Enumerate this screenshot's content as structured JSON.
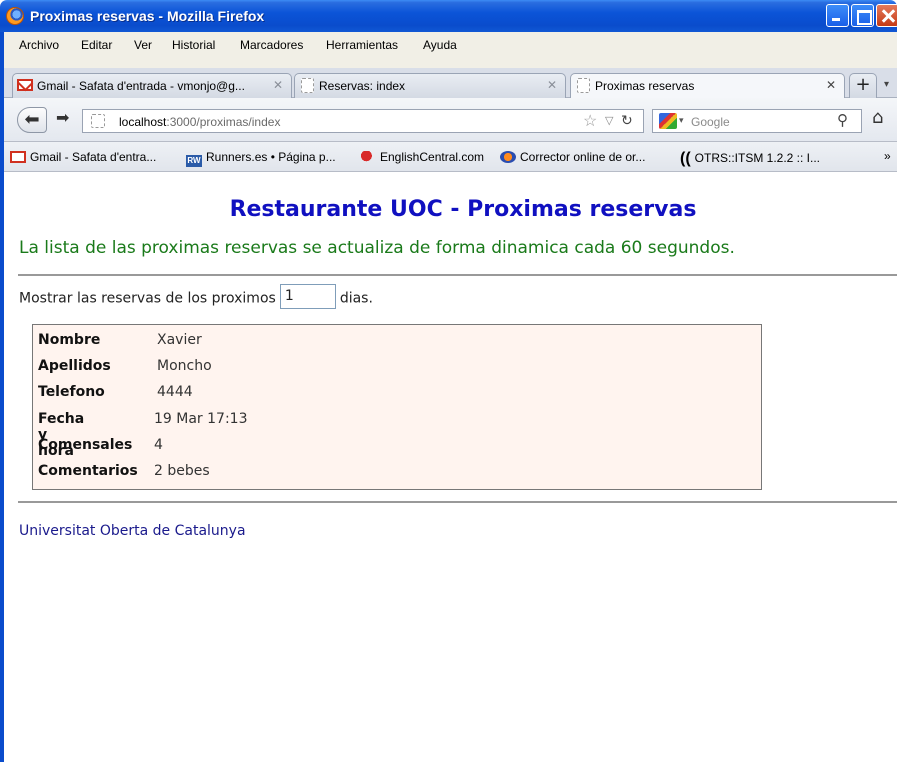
{
  "window": {
    "title": "Proximas reservas - Mozilla Firefox"
  },
  "menubar": {
    "items": [
      "Archivo",
      "Editar",
      "Ver",
      "Historial",
      "Marcadores",
      "Herramientas",
      "Ayuda"
    ]
  },
  "tabs": [
    {
      "label": "Gmail - Safata d'entrada - vmonjo@g...",
      "icon": "gmail-icon",
      "active": false
    },
    {
      "label": "Reservas: index",
      "icon": "page-icon",
      "active": false
    },
    {
      "label": "Proximas reservas",
      "icon": "page-icon",
      "active": true
    }
  ],
  "navbar": {
    "url_host": "localhost",
    "url_path": ":3000/proximas/index",
    "search_placeholder": "Google"
  },
  "bookmarks": [
    {
      "label": "Gmail - Safata d'entra...",
      "icon": "gmail-icon"
    },
    {
      "label": "Runners.es • Página p...",
      "icon": "rw-icon"
    },
    {
      "label": "EnglishCentral.com",
      "icon": "englishcentral-icon"
    },
    {
      "label": "Corrector online de or...",
      "icon": "corrector-icon"
    },
    {
      "label": "OTRS::ITSM 1.2.2 :: I...",
      "icon": "otrs-icon"
    }
  ],
  "page": {
    "title": "Restaurante UOC - Proximas reservas",
    "subtitle": "La lista de las proximas reservas se actualiza de forma dinamica cada 60 segundos.",
    "filter_prefix": "Mostrar las reservas de los proximos",
    "filter_days_value": "1",
    "filter_suffix": "dias.",
    "reservation": [
      {
        "label": "Nombre",
        "value": "Xavier"
      },
      {
        "label": "Apellidos",
        "value": "Moncho"
      },
      {
        "label": "Telefono",
        "value": "4444"
      },
      {
        "label": "Fecha y hora",
        "value": "19 Mar 17:13"
      },
      {
        "label": "Comensales",
        "value": "4"
      },
      {
        "label": "Comentarios",
        "value": "2 bebes"
      }
    ],
    "footer_link": "Universitat Oberta de Catalunya"
  },
  "colors": {
    "title_blue": "#1010c0",
    "subtitle_green": "#1a7a1a",
    "reservation_bg": "#fff4ef",
    "titlebar_blue": "#0b54d8"
  }
}
